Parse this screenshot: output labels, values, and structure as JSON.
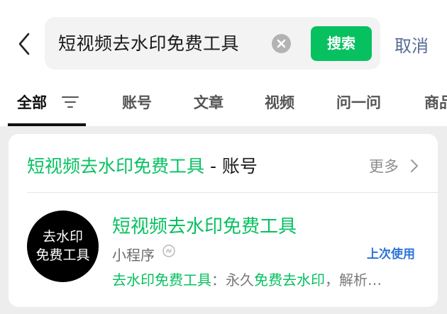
{
  "search": {
    "query": "短视频去水印免费工具",
    "button_label": "搜索",
    "cancel_label": "取消"
  },
  "tabs": [
    {
      "label": "全部",
      "active": true
    },
    {
      "label": "账号",
      "active": false
    },
    {
      "label": "文章",
      "active": false
    },
    {
      "label": "视频",
      "active": false
    },
    {
      "label": "问一问",
      "active": false
    },
    {
      "label": "商品",
      "active": false
    }
  ],
  "section": {
    "keyword": "短视频去水印免费工具",
    "suffix": " - 账号",
    "more_label": "更多"
  },
  "result": {
    "avatar_line1": "去水印",
    "avatar_line2": "免费工具",
    "title": "短视频去水印免费工具",
    "type": "小程序",
    "recent_label": "上次使用",
    "desc_part1": "去水印免费工具",
    "desc_part2": "：永久",
    "desc_part3": "免费去水印",
    "desc_part4": "，解析…"
  },
  "colors": {
    "accent_green": "#07c160",
    "link_blue": "#576b95",
    "recent_blue": "#2c74d6"
  },
  "icons": [
    "back-chevron-icon",
    "clear-icon",
    "filter-icon",
    "chevron-right-icon",
    "mini-program-icon"
  ]
}
